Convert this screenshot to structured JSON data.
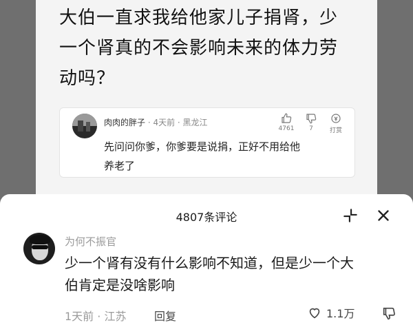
{
  "question": {
    "lines": [
      "大伯一直求我给他家儿子捐肾，少",
      "一个肾真的不会影响未来的体力劳",
      "动吗？"
    ]
  },
  "embedded_comment": {
    "username": "肉肉的胖子",
    "time_location": "· 4天前 · 黑龙江",
    "likes": "4761",
    "dislikes": "7",
    "reward_label": "打赏",
    "text_lines": [
      "先问问你爹，你爹要是说捐，正好不用给他",
      "养老了"
    ]
  },
  "comments_sheet": {
    "title": "4807条评论",
    "comment": {
      "username": "为何不振官",
      "text_lines": [
        "少一个肾有没有什么影响不知道，但是少一个大",
        "伯肯定是没啥影响"
      ],
      "meta": "1天前 · 江苏",
      "reply_label": "回复",
      "like_count": "1.1万"
    }
  },
  "icons": [
    "thumb-up-icon",
    "thumb-down-icon",
    "reward-icon",
    "shrink-icon",
    "close-icon",
    "heart-icon",
    "thumb-down-icon"
  ]
}
